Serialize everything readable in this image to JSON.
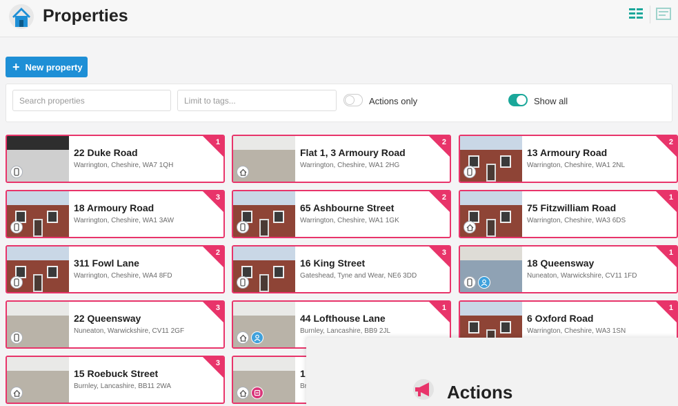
{
  "header": {
    "title": "Properties",
    "icon": "home-icon"
  },
  "toolbar": {
    "new_property_label": "New property"
  },
  "filters": {
    "search_placeholder": "Search properties",
    "tags_placeholder": "Limit to tags...",
    "actions_only_label": "Actions only",
    "actions_only_on": false,
    "show_all_label": "Show all",
    "show_all_on": true
  },
  "colors": {
    "accent": "#1e8fd6",
    "card_border": "#e8346a",
    "toggle_on": "#1aa79a"
  },
  "properties": [
    {
      "address": "22 Duke Road",
      "location": "Warrington, Cheshire, WA7 1QH",
      "count": "1",
      "icons": [
        "phone-icon"
      ]
    },
    {
      "address": "Flat 1, 3 Armoury Road",
      "location": "Warrington, Cheshire, WA1 2HG",
      "count": "2",
      "icons": [
        "house-icon"
      ]
    },
    {
      "address": "13 Armoury Road",
      "location": "Warrington, Cheshire, WA1 2NL",
      "count": "2",
      "icons": [
        "phone-icon"
      ]
    },
    {
      "address": "18 Armoury Road",
      "location": "Warrington, Cheshire, WA1 3AW",
      "count": "3",
      "icons": [
        "phone-icon"
      ]
    },
    {
      "address": "65 Ashbourne Street",
      "location": "Warrington, Cheshire, WA1 1GK",
      "count": "2",
      "icons": [
        "phone-icon"
      ]
    },
    {
      "address": "75 Fitzwilliam Road",
      "location": "Warrington, Cheshire, WA3 6DS",
      "count": "1",
      "icons": [
        "house-icon"
      ]
    },
    {
      "address": "311 Fowl Lane",
      "location": "Warrington, Cheshire, WA4 8FD",
      "count": "2",
      "icons": [
        "phone-icon"
      ]
    },
    {
      "address": "16 King Street",
      "location": "Gateshead, Tyne and Wear, NE6 3DD",
      "count": "3",
      "icons": [
        "phone-icon"
      ]
    },
    {
      "address": "18 Queensway",
      "location": "Nuneaton, Warwickshire, CV11 1FD",
      "count": "1",
      "icons": [
        "phone-icon",
        "person-icon"
      ]
    },
    {
      "address": "22 Queensway",
      "location": "Nuneaton, Warwickshire, CV11 2GF",
      "count": "3",
      "icons": [
        "phone-icon"
      ]
    },
    {
      "address": "44 Lofthouse Lane",
      "location": "Burnley, Lancashire, BB9 2JL",
      "count": "1",
      "icons": [
        "house-icon",
        "person-icon"
      ]
    },
    {
      "address": "6 Oxford Road",
      "location": "Warrington, Cheshire, WA3 1SN",
      "count": "1",
      "icons": []
    },
    {
      "address": "15 Roebuck Street",
      "location": "Burnley, Lancashire, BB11 2WA",
      "count": "3",
      "icons": [
        "house-icon"
      ]
    },
    {
      "address": "1",
      "location": "Br",
      "count": "",
      "icons": [
        "house-icon",
        "tag-icon"
      ]
    }
  ],
  "actions_panel": {
    "title": "Actions",
    "icon": "megaphone-icon"
  }
}
